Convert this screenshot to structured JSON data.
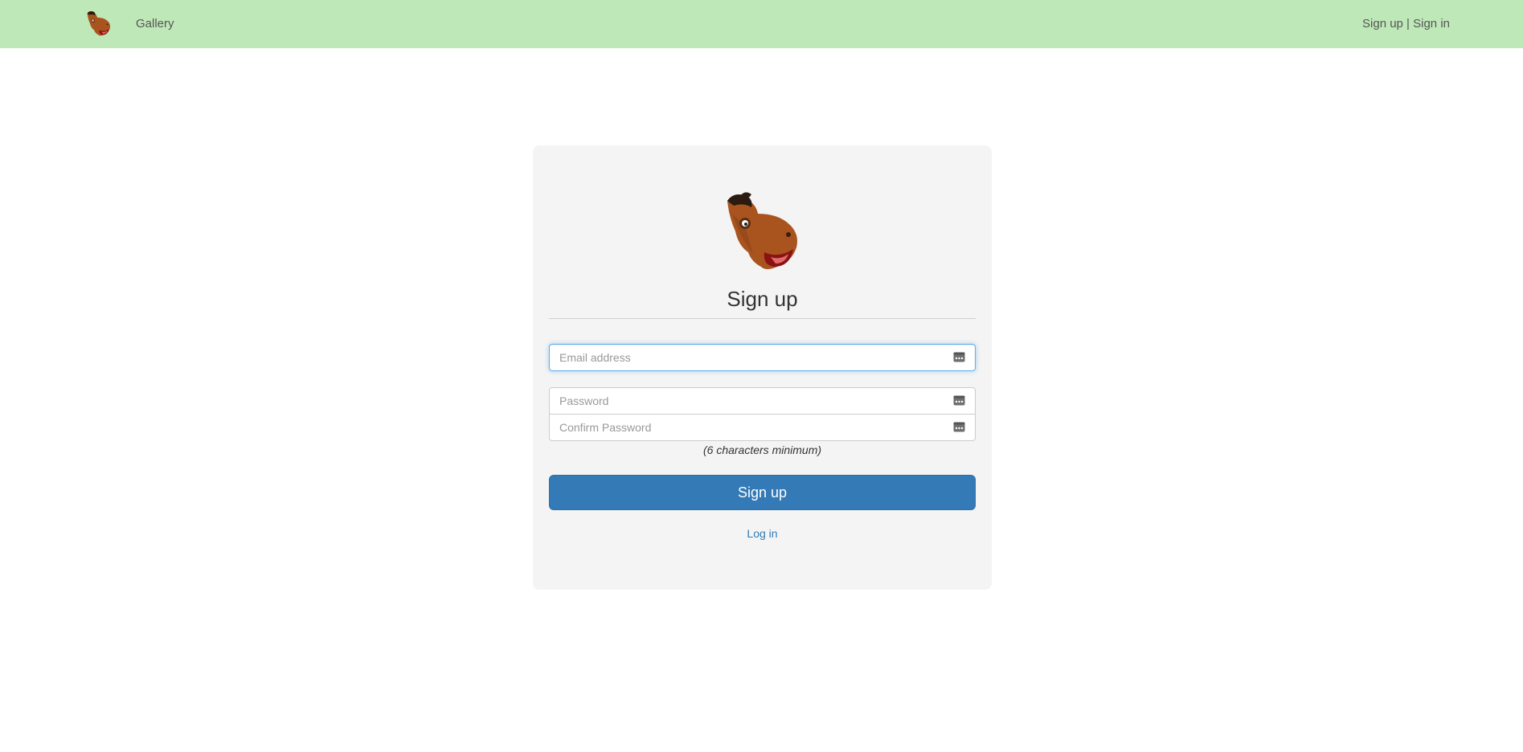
{
  "navbar": {
    "logo_icon": "camel-mascot-icon",
    "gallery_label": "Gallery",
    "signup_label": "Sign up",
    "separator": " | ",
    "signin_label": "Sign in",
    "background_color": "#bfe8b8"
  },
  "card": {
    "logo_icon": "camel-mascot-icon",
    "title": "Sign up",
    "email": {
      "placeholder": "Email address",
      "value": ""
    },
    "password": {
      "placeholder": "Password",
      "value": ""
    },
    "confirm_password": {
      "placeholder": "Confirm Password",
      "value": ""
    },
    "field_icon": "password-manager-key-icon",
    "hint": "(6 characters minimum)",
    "submit_label": "Sign up",
    "login_label": "Log in",
    "accent_color": "#337ab7"
  }
}
